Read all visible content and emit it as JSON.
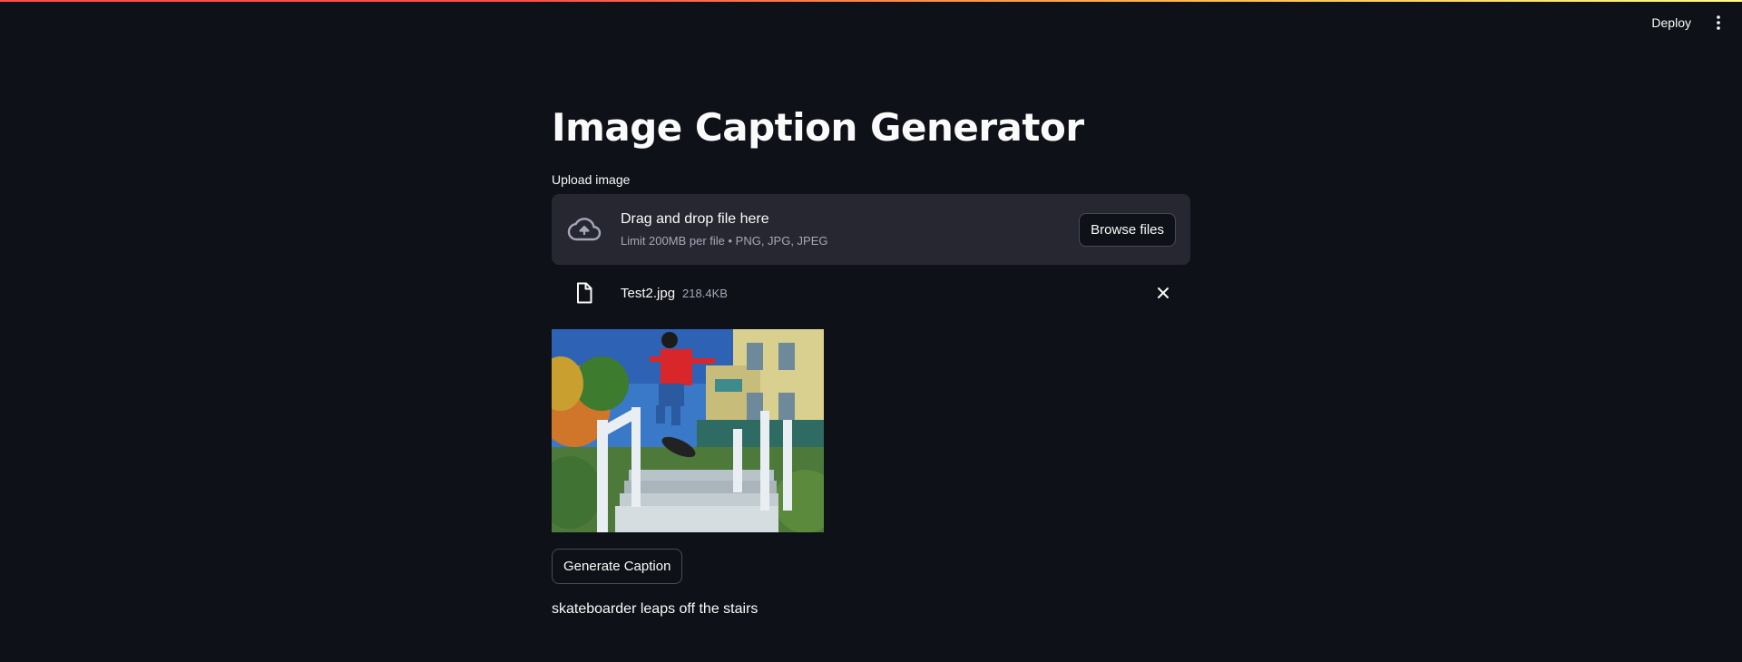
{
  "header": {
    "deploy_label": "Deploy",
    "menu_icon": "vertical-ellipsis-icon"
  },
  "main": {
    "title": "Image Caption Generator",
    "uploader": {
      "label": "Upload image",
      "drop_title": "Drag and drop file here",
      "drop_subtitle": "Limit 200MB per file • PNG, JPG, JPEG",
      "browse_label": "Browse files",
      "icon": "cloud-upload-icon"
    },
    "uploaded_file": {
      "name": "Test2.jpg",
      "size": "218.4KB",
      "icon": "file-icon",
      "remove_icon": "close-icon"
    },
    "generate_label": "Generate Caption",
    "caption": "skateboarder leaps off the stairs"
  },
  "colors": {
    "background": "#0e1117",
    "surface": "#262730",
    "text": "#fafafa",
    "muted": "#a3a8b8",
    "accent_red": "#ff4b4b",
    "accent_yellow": "#fffd80"
  }
}
